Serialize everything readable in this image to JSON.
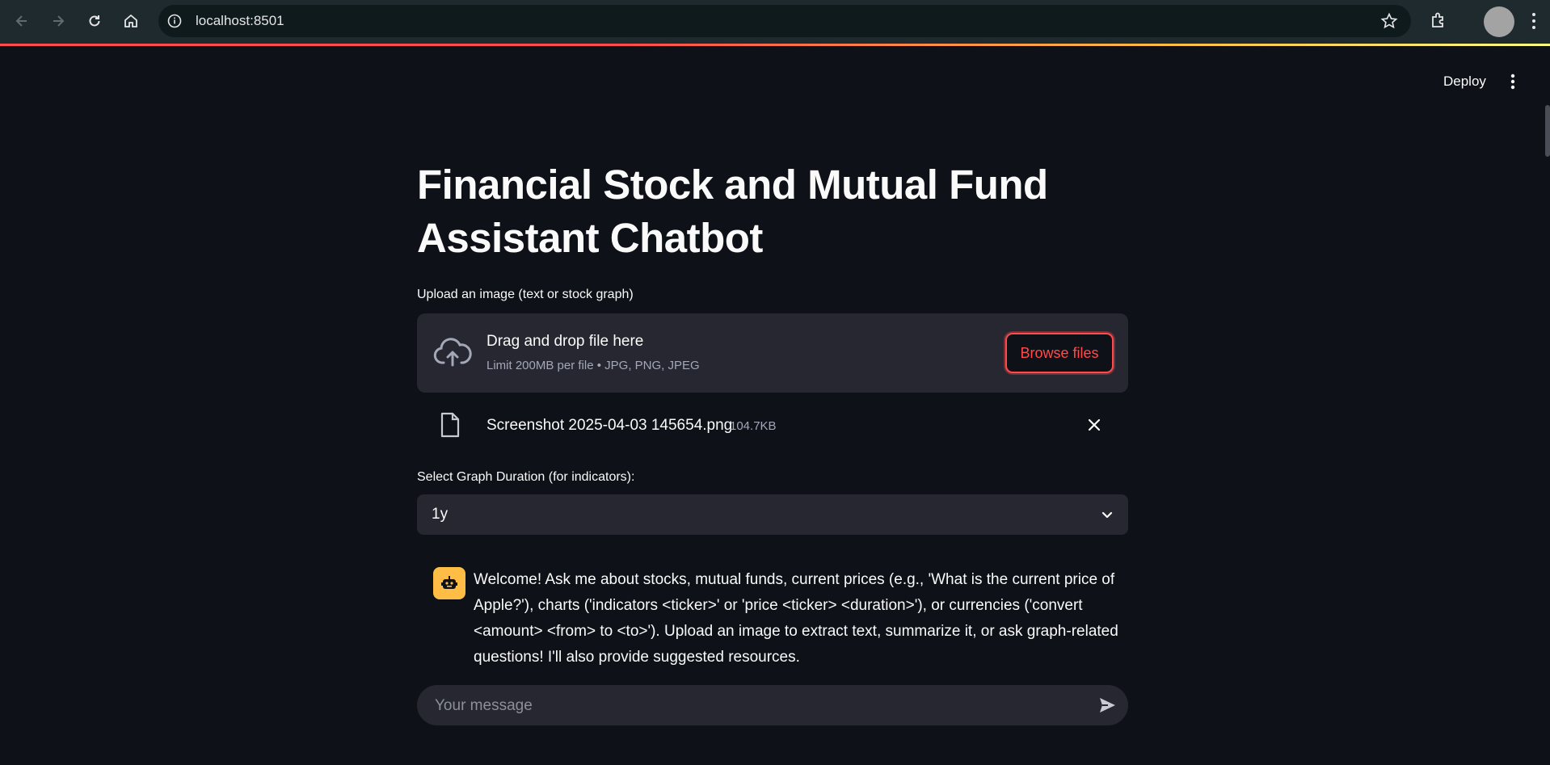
{
  "browser": {
    "url": "localhost:8501"
  },
  "header": {
    "deploy_label": "Deploy"
  },
  "main": {
    "title": "Financial Stock and Mutual Fund Assistant Chatbot",
    "upload": {
      "label": "Upload an image (text or stock graph)",
      "dropzone_title": "Drag and drop file here",
      "dropzone_sub": "Limit 200MB per file • JPG, PNG, JPEG",
      "browse_label": "Browse files",
      "file_name": "Screenshot 2025-04-03 145654.png",
      "file_size": "104.7KB"
    },
    "duration": {
      "label": "Select Graph Duration (for indicators):",
      "value": "1y"
    },
    "chat": {
      "welcome": "Welcome! Ask me about stocks, mutual funds, current prices (e.g., 'What is the current price of Apple?'), charts ('indicators <ticker>' or 'price <ticker> <duration>'), or currencies ('convert <amount> <from> to <to>'). Upload an image to extract text, summarize it, or ask graph-related questions! I'll also provide suggested resources.",
      "input_placeholder": "Your message"
    }
  },
  "colors": {
    "background": "#0e1117",
    "surface": "#262730",
    "accent": "#ff4b4b",
    "bot_avatar": "#ffbd45"
  },
  "icons": [
    "back-icon",
    "forward-icon",
    "reload-icon",
    "home-icon",
    "site-info-icon",
    "bookmark-star-icon",
    "extensions-icon",
    "profile-avatar",
    "chrome-menu-icon",
    "app-menu-icon",
    "upload-cloud-icon",
    "file-icon",
    "close-icon",
    "chevron-down-icon",
    "bot-icon",
    "send-icon"
  ]
}
